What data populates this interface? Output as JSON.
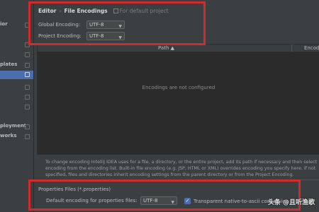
{
  "sidebar": {
    "items": [
      {
        "label": "ior",
        "selected": false
      },
      {
        "label": "",
        "selected": false
      },
      {
        "label": "",
        "selected": false
      },
      {
        "label": "plates",
        "selected": false
      },
      {
        "label": "",
        "selected": true
      },
      {
        "label": "",
        "selected": false
      },
      {
        "label": "",
        "selected": false
      },
      {
        "label": "",
        "selected": false
      },
      {
        "label": "ployment",
        "selected": false
      },
      {
        "label": "works",
        "selected": false
      }
    ]
  },
  "breadcrumb": {
    "parent": "Editor",
    "separator": "›",
    "current": "File Encodings",
    "scope": "For default project"
  },
  "global_encoding": {
    "label": "Global Encoding:",
    "value": "UTF-8"
  },
  "project_encoding": {
    "label": "Project Encoding:",
    "value": "UTF-8"
  },
  "table": {
    "columns": [
      "Path ▲",
      "Encoding"
    ],
    "empty_text": "Encodings are not configured"
  },
  "info_text": "To change encoding IntelliJ IDEA uses for a file, a directory, or the entire project, add its path if necessary and then select encoding from the encoding list. Built-in file encoding (e.g. JSP, HTML or XML) overrides encoding you specify here. If not specified, files and directories inherit encoding settings from the parent directory or from the Project Encoding.",
  "properties_files": {
    "title": "Properties Files (*.properties)",
    "default_label": "Default encoding for properties files:",
    "default_value": "UTF-8",
    "transparent_label": "Transparent native-to-ascii conversion",
    "transparent_checked": true
  },
  "watermark": "头条 @且听渔歌",
  "colors": {
    "highlight": "#d22b2b",
    "selection": "#4b6eaf",
    "background": "#3c3f41"
  }
}
